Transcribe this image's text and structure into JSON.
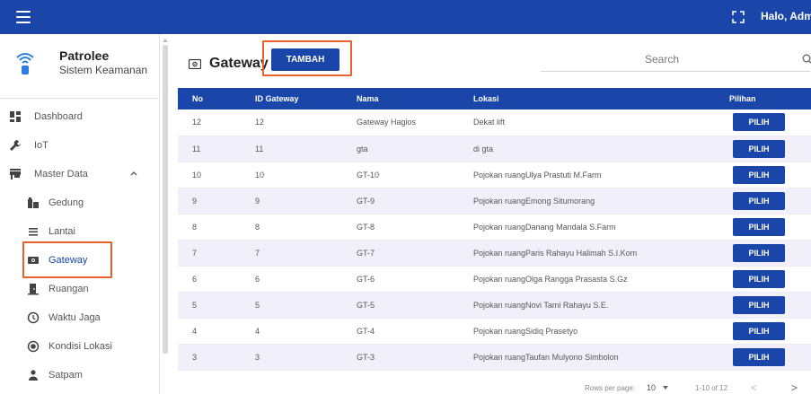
{
  "header": {
    "user_label": "Halo, Admin"
  },
  "brand": {
    "title": "Patrolee",
    "subtitle": "Sistem Keamanan"
  },
  "sidebar": {
    "items": [
      {
        "label": "Dashboard",
        "icon": "dashboard-icon"
      },
      {
        "label": "IoT",
        "icon": "wrench-icon"
      },
      {
        "label": "Master Data",
        "icon": "storefront-icon"
      },
      {
        "label": "Gedung",
        "icon": "building-icon"
      },
      {
        "label": "Lantai",
        "icon": "list-icon"
      },
      {
        "label": "Gateway",
        "icon": "gateway-icon"
      },
      {
        "label": "Ruangan",
        "icon": "door-icon"
      },
      {
        "label": "Waktu Jaga",
        "icon": "clock-icon"
      },
      {
        "label": "Kondisi Lokasi",
        "icon": "radio-icon"
      },
      {
        "label": "Satpam",
        "icon": "person-icon"
      }
    ]
  },
  "page": {
    "title": "Gateway",
    "add_label": "TAMBAH",
    "search_placeholder": "Search"
  },
  "table": {
    "headers": [
      "No",
      "ID Gateway",
      "Nama",
      "Lokasi",
      "Pilihan"
    ],
    "rows": [
      {
        "no": "12",
        "id": "12",
        "nama": "Gateway Hagios",
        "lokasi": "Dekat lift",
        "action": "PILIH"
      },
      {
        "no": "11",
        "id": "11",
        "nama": "gta",
        "lokasi": "di gta",
        "action": "PILIH"
      },
      {
        "no": "10",
        "id": "10",
        "nama": "GT-10",
        "lokasi": "Pojokan ruangUlya Prastuti M.Farm",
        "action": "PILIH"
      },
      {
        "no": "9",
        "id": "9",
        "nama": "GT-9",
        "lokasi": "Pojokan ruangEmong Situmorang",
        "action": "PILIH"
      },
      {
        "no": "8",
        "id": "8",
        "nama": "GT-8",
        "lokasi": "Pojokan ruangDanang Mandala S.Farm",
        "action": "PILIH"
      },
      {
        "no": "7",
        "id": "7",
        "nama": "GT-7",
        "lokasi": "Pojokan ruangParis Rahayu Halimah S.I.Kom",
        "action": "PILIH"
      },
      {
        "no": "6",
        "id": "6",
        "nama": "GT-6",
        "lokasi": "Pojokan ruangOlga Rangga Prasasta S.Gz",
        "action": "PILIH"
      },
      {
        "no": "5",
        "id": "5",
        "nama": "GT-5",
        "lokasi": "Pojokan ruangNovi Tami Rahayu S.E.",
        "action": "PILIH"
      },
      {
        "no": "4",
        "id": "4",
        "nama": "GT-4",
        "lokasi": "Pojokan ruangSidiq Prasetyo",
        "action": "PILIH"
      },
      {
        "no": "3",
        "id": "3",
        "nama": "GT-3",
        "lokasi": "Pojokan ruangTaufan Mulyono Simbolon",
        "action": "PILIH"
      }
    ]
  },
  "pagination": {
    "rows_label": "Rows per page:",
    "rows_value": "10",
    "range": "1-10 of 12",
    "prev": "<",
    "next": ">"
  },
  "colors": {
    "primary": "#1946a8",
    "highlight": "#e8602c",
    "row_alt": "#f1f0fa"
  }
}
